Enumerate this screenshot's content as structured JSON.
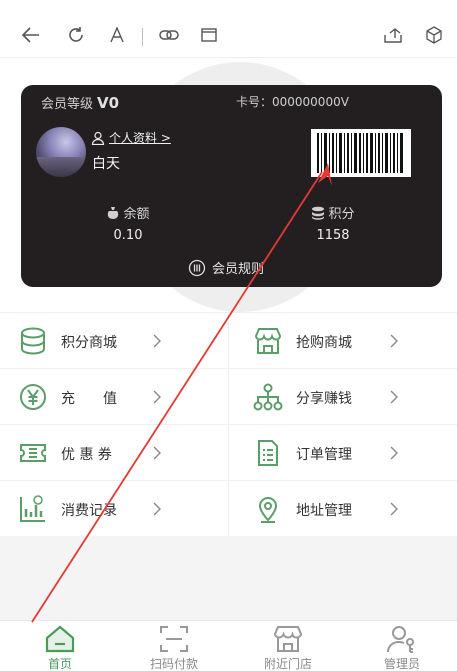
{
  "toolbar": {
    "icons": [
      "back-icon",
      "refresh-icon",
      "font-icon",
      "link-icon",
      "window-icon",
      "share-icon",
      "cube-icon"
    ]
  },
  "card": {
    "level_label": "会员等级",
    "level_value": "V0",
    "card_no": "卡号：000000000V",
    "profile_link": "个人资料 >",
    "username": "白天",
    "balance_label": "余额",
    "balance_value": "0.10",
    "points_label": "积分",
    "points_value": "1158",
    "rules_label": "会员规则"
  },
  "menu": [
    {
      "label": "积分商城",
      "icon": "database-icon"
    },
    {
      "label": "抢购商城",
      "icon": "shop-icon"
    },
    {
      "label": "充　　值",
      "icon": "yen-icon"
    },
    {
      "label": "分享赚钱",
      "icon": "share-tree-icon"
    },
    {
      "label": "优 惠 券",
      "icon": "coupon-icon"
    },
    {
      "label": "订单管理",
      "icon": "order-icon"
    },
    {
      "label": "消费记录",
      "icon": "chart-icon"
    },
    {
      "label": "地址管理",
      "icon": "location-icon"
    }
  ],
  "tabs": [
    {
      "label": "首页",
      "icon": "home-icon",
      "active": true
    },
    {
      "label": "扫码付款",
      "icon": "scan-icon",
      "active": false
    },
    {
      "label": "附近门店",
      "icon": "store-icon",
      "active": false
    },
    {
      "label": "管理员",
      "icon": "admin-icon",
      "active": false
    }
  ],
  "colors": {
    "accent": "#4a9a5c",
    "card_bg": "#231f20",
    "annotation": "#e53935"
  }
}
